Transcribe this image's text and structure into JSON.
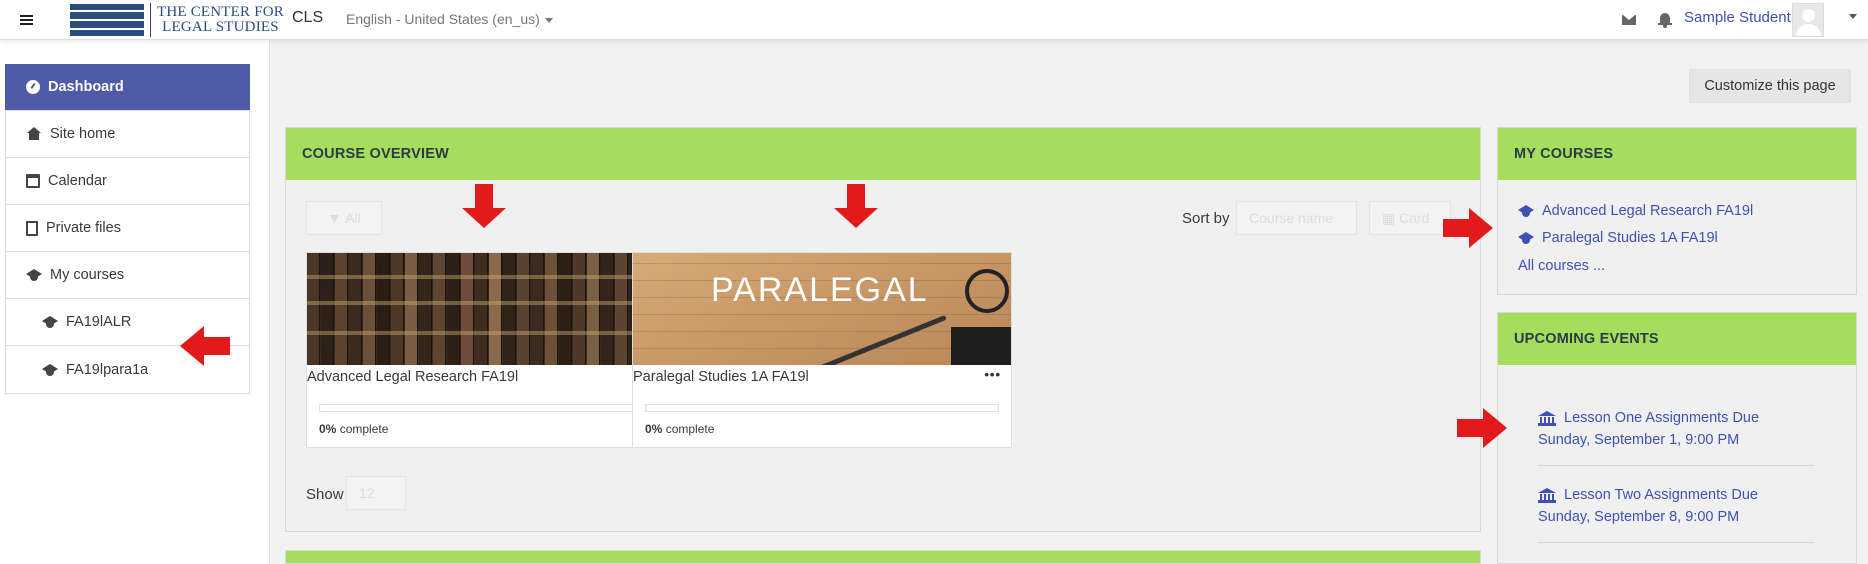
{
  "navbar": {
    "logo_line1": "THE CENTER FOR",
    "logo_line2": "LEGAL STUDIES",
    "site_short": "CLS",
    "language": "English - United States (en_us)",
    "user_name": "Sample Student"
  },
  "sidebar": {
    "items": [
      {
        "label": "Dashboard",
        "icon": "dashboard-icon",
        "active": true
      },
      {
        "label": "Site home",
        "icon": "home-icon"
      },
      {
        "label": "Calendar",
        "icon": "calendar-icon"
      },
      {
        "label": "Private files",
        "icon": "file-icon"
      },
      {
        "label": "My courses",
        "icon": "graduation-cap-icon"
      },
      {
        "label": "FA19lALR",
        "icon": "graduation-cap-icon"
      },
      {
        "label": "FA19lpara1a",
        "icon": "graduation-cap-icon"
      }
    ]
  },
  "page": {
    "customize_label": "Customize this page"
  },
  "course_overview": {
    "title": "COURSE OVERVIEW",
    "filter_label": "All",
    "sort_label": "Sort by",
    "sort_value": "Course name",
    "view_value": "Card",
    "show_label": "Show",
    "show_value": "12",
    "courses": [
      {
        "name": "Advanced Legal Research FA19l",
        "progress_percent": 0,
        "progress_value": "0%",
        "progress_suffix": "complete",
        "image": "books-image",
        "menu": "•••"
      },
      {
        "name": "Paralegal Studies 1A FA19l",
        "progress_percent": 0,
        "progress_value": "0%",
        "progress_suffix": "complete",
        "image": "paralegal-image",
        "image_text": "PARALEGAL",
        "menu": "•••"
      }
    ]
  },
  "my_courses": {
    "title": "MY COURSES",
    "links": [
      "Advanced Legal Research FA19l",
      "Paralegal Studies 1A FA19l"
    ],
    "all_label": "All courses ..."
  },
  "upcoming_events": {
    "title": "UPCOMING EVENTS",
    "events": [
      {
        "title": "Lesson One Assignments Due",
        "date": "Sunday, September 1, 9:00 PM"
      },
      {
        "title": "Lesson Two Assignments Due",
        "date": "Sunday, September 8, 9:00 PM"
      }
    ]
  },
  "colors": {
    "accent": "#4f5aa8",
    "block_header": "#a5de5c",
    "link": "#3f51b5",
    "annotation_arrow": "#e31a1c"
  }
}
